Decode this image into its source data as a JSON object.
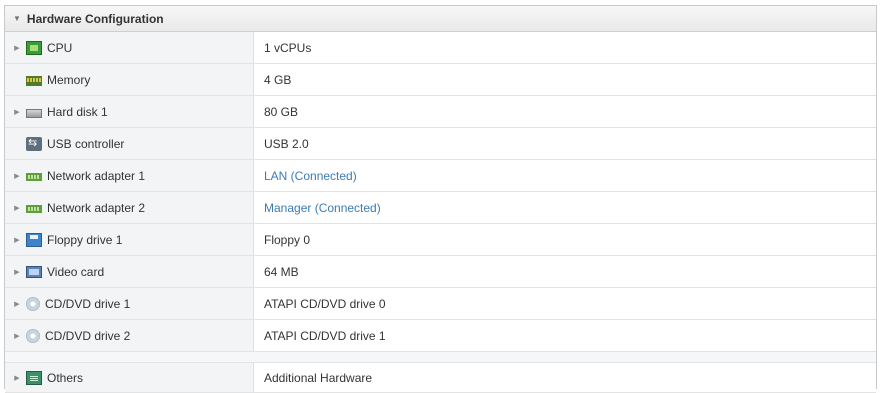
{
  "panel": {
    "title": "Hardware Configuration",
    "expander_open": "▼",
    "expander_closed": "▶"
  },
  "rows": [
    {
      "name": "CPU",
      "value": "1 vCPUs",
      "icon": "cpu-icon",
      "expandable": true,
      "link": false
    },
    {
      "name": "Memory",
      "value": "4 GB",
      "icon": "memory-icon",
      "expandable": false,
      "link": false
    },
    {
      "name": "Hard disk 1",
      "value": "80 GB",
      "icon": "hard-disk-icon",
      "expandable": true,
      "link": false
    },
    {
      "name": "USB controller",
      "value": "USB 2.0",
      "icon": "usb-icon",
      "expandable": false,
      "link": false
    },
    {
      "name": "Network adapter 1",
      "value": "LAN (Connected)",
      "icon": "network-adapter-icon",
      "expandable": true,
      "link": true
    },
    {
      "name": "Network adapter 2",
      "value": "Manager (Connected)",
      "icon": "network-adapter-icon",
      "expandable": true,
      "link": true
    },
    {
      "name": "Floppy drive 1",
      "value": "Floppy 0",
      "icon": "floppy-icon",
      "expandable": true,
      "link": false
    },
    {
      "name": "Video card",
      "value": "64 MB",
      "icon": "video-card-icon",
      "expandable": true,
      "link": false
    },
    {
      "name": "CD/DVD drive 1",
      "value": "ATAPI CD/DVD drive 0",
      "icon": "cd-dvd-icon",
      "expandable": true,
      "link": false
    },
    {
      "name": "CD/DVD drive 2",
      "value": "ATAPI CD/DVD drive 1",
      "icon": "cd-dvd-icon",
      "expandable": true,
      "link": false
    },
    {
      "name": "Others",
      "value": "Additional Hardware",
      "icon": "others-icon",
      "expandable": true,
      "link": false
    }
  ],
  "colors": {
    "link": "#3b7cb5",
    "name_cell_bg": "#f3f4f6",
    "header_bg": "#ececec"
  }
}
